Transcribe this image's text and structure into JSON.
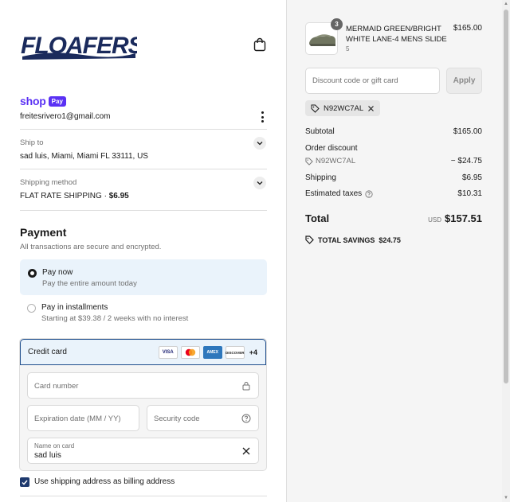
{
  "brand": {
    "logo_text": "FLOAFERS"
  },
  "express": {
    "shop_label": "shop",
    "pay_label": "Pay",
    "email": "freitesrivero1@gmail.com"
  },
  "ship_to": {
    "label": "Ship to",
    "value": "sad luis, Miami, Miami FL 33111, US"
  },
  "shipping_method": {
    "label": "Shipping method",
    "value": "FLAT RATE SHIPPING · ",
    "price": "$6.95"
  },
  "payment": {
    "title": "Payment",
    "subtitle": "All transactions are secure and encrypted.",
    "options": [
      {
        "title": "Pay now",
        "subtitle": "Pay the entire amount today",
        "selected": true
      },
      {
        "title": "Pay in installments",
        "subtitle": "Starting at $39.38 / 2 weeks with no interest",
        "selected": false
      }
    ],
    "credit_card": {
      "label": "Credit card",
      "brands": [
        "VISA",
        "Mastercard",
        "AMEX",
        "DISCOVER"
      ],
      "more": "+4",
      "card_number_placeholder": "Card number",
      "expiration_placeholder": "Expiration date (MM / YY)",
      "security_placeholder": "Security code",
      "name_label": "Name on card",
      "name_value": "sad luis"
    },
    "billing_checkbox_label": "Use shipping address as billing address",
    "billing_checked": true
  },
  "order": {
    "item": {
      "quantity": "3",
      "name": "MERMAID GREEN/BRIGHT WHITE LANE-4 MENS SLIDE",
      "variant": "5",
      "price": "$165.00"
    },
    "discount_placeholder": "Discount code or gift card",
    "apply_label": "Apply",
    "applied_code": "N92WC7AL",
    "subtotal_label": "Subtotal",
    "subtotal_value": "$165.00",
    "order_discount_label": "Order discount",
    "discount_code": "N92WC7AL",
    "discount_value": "− $24.75",
    "shipping_label": "Shipping",
    "shipping_value": "$6.95",
    "taxes_label": "Estimated taxes",
    "taxes_value": "$10.31",
    "total_label": "Total",
    "currency": "USD",
    "total_value": "$157.51",
    "savings_label": "TOTAL SAVINGS",
    "savings_value": "$24.75"
  },
  "colors": {
    "shop_pay": "#5a31f4",
    "accent": "#1f4e8c",
    "selected_bg": "#eaf3fb"
  }
}
